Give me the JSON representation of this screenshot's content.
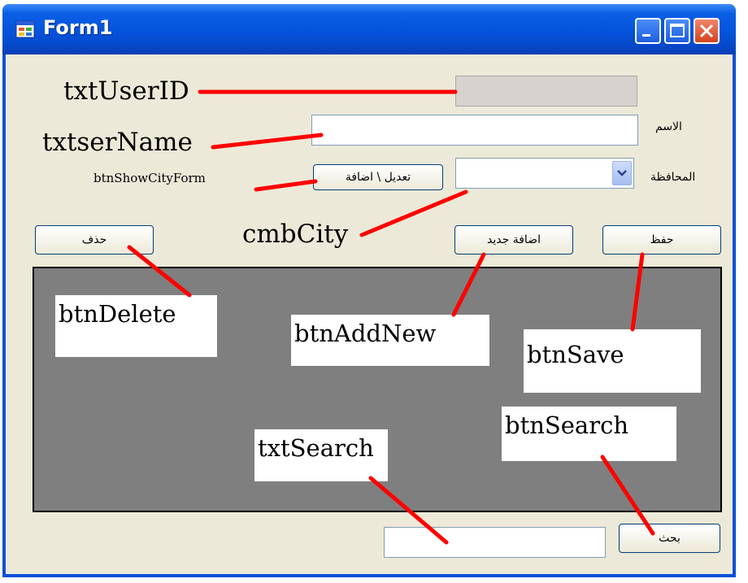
{
  "window": {
    "title": "Form1"
  },
  "form": {
    "user_id_value": "",
    "user_name_value": "",
    "name_label": "الاسم",
    "governorate_label": "المحافظة",
    "city_value": "",
    "edit_add_button": "تعديل \\ اضافة",
    "delete_button": "حذف",
    "add_new_button": "اضافة جديد",
    "save_button": "حفظ",
    "search_value": "",
    "search_button": "بحث"
  },
  "annotations": {
    "txtUserID": "txtUserID",
    "txtUserName": "txtserName",
    "btnShowCityForm": "btnShowCityForm",
    "cmbCity": "cmbCity",
    "btnDelete": "btnDelete",
    "btnAddNew": "btnAddNew",
    "btnSave": "btnSave",
    "txtSearch": "txtSearch",
    "btnSearch": "btnSearch"
  },
  "colors": {
    "titlebar": "#0553dc",
    "form_background": "#ece9d8",
    "panel": "#7f7f7f",
    "callout_line": "#ff0000"
  }
}
